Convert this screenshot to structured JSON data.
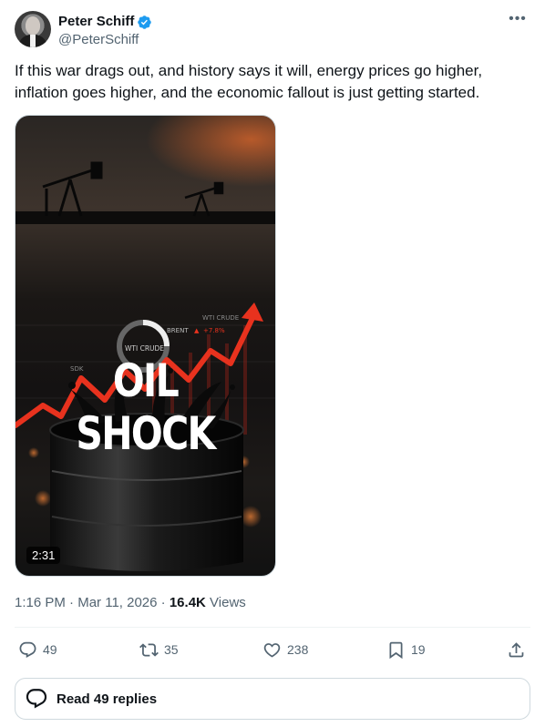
{
  "author": {
    "display_name": "Peter Schiff",
    "handle": "@PeterSchiff",
    "verified": true
  },
  "more_icon": "more-horizontal-icon",
  "tweet": {
    "text": "If this war drags out, and history says it will, energy prices go higher, inflation goes higher, and the economic fallout is just getting started."
  },
  "media": {
    "type": "video",
    "title": "OIL SHOCK",
    "duration": "2:31",
    "overlay_labels": {
      "brent": "BRENT",
      "brent_change": "+7.8%",
      "wti_crude": "WTI CRUDE",
      "wti_crude_ring": "WTI CRUDE",
      "sdk": "SDK"
    }
  },
  "meta": {
    "time": "1:16 PM",
    "separator": "·",
    "date": "Mar 11, 2026",
    "views_count": "16.4K",
    "views_label": "Views"
  },
  "actions": {
    "replies": "49",
    "reposts": "35",
    "likes": "238",
    "bookmarks": "19"
  },
  "read_replies": {
    "label": "Read 49 replies"
  },
  "colors": {
    "verified": "#1d9bf0",
    "text": "#0f1419",
    "secondary": "#536471",
    "border": "#cfd9de",
    "arrow": "#e8321e"
  }
}
